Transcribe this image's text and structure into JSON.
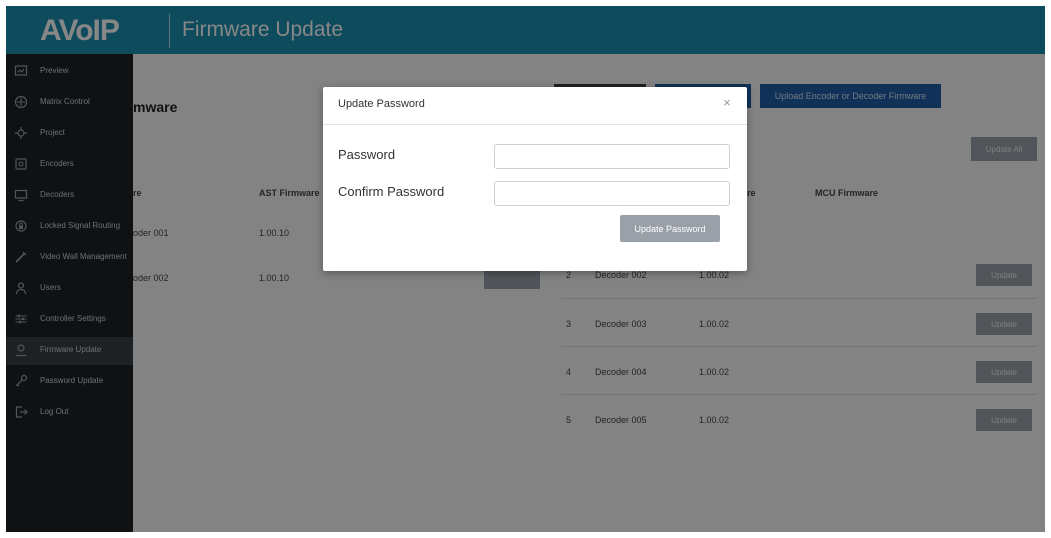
{
  "header": {
    "logo": "AVoIP",
    "title": "Firmware Update"
  },
  "sidebar": {
    "items": [
      {
        "label": "Preview",
        "icon": "preview-icon"
      },
      {
        "label": "Matrix Control",
        "icon": "matrix-icon"
      },
      {
        "label": "Project",
        "icon": "project-icon"
      },
      {
        "label": "Encoders",
        "icon": "encoder-icon"
      },
      {
        "label": "Decoders",
        "icon": "decoder-icon"
      },
      {
        "label": "Locked Signal Routing",
        "icon": "lock-icon"
      },
      {
        "label": "Video Wall Management",
        "icon": "videowall-icon"
      },
      {
        "label": "Users",
        "icon": "user-icon"
      },
      {
        "label": "Controller Settings",
        "icon": "settings-icon"
      },
      {
        "label": "Firmware Update",
        "icon": "firmware-icon",
        "active": true
      },
      {
        "label": "Password Update",
        "icon": "key-icon"
      },
      {
        "label": "Log Out",
        "icon": "logout-icon"
      }
    ]
  },
  "main": {
    "section_title": "mware",
    "upload_button": "Upload Encoder or Decoder Firmware",
    "update_all_button": "Update All",
    "encoders_table": {
      "headers": [
        "re",
        "AST Firmware"
      ],
      "rows": [
        {
          "name": "oder 001",
          "ast": "1.00.10"
        },
        {
          "name": "oder 002",
          "ast": "1.00.10"
        }
      ]
    },
    "decoders_table": {
      "headers": [
        "ware",
        "MCU Firmware"
      ],
      "rows": [
        {
          "num": "2",
          "name": "Decoder 002",
          "fw": "1.00.02"
        },
        {
          "num": "3",
          "name": "Decoder 003",
          "fw": "1.00.02"
        },
        {
          "num": "4",
          "name": "Decoder 004",
          "fw": "1.00.02"
        },
        {
          "num": "5",
          "name": "Decoder 005",
          "fw": "1.00.02"
        }
      ],
      "update_label": "Update"
    }
  },
  "modal": {
    "title": "Update Password",
    "close_glyph": "×",
    "password_label": "Password",
    "password_value": "",
    "confirm_label": "Confirm Password",
    "confirm_value": "",
    "submit_label": "Update Password"
  },
  "colors": {
    "header_bg": "#1a8fb0",
    "sidebar_bg": "#1e2125",
    "accent_blue": "#1f5fa8",
    "button_gray": "#99a0a8"
  }
}
